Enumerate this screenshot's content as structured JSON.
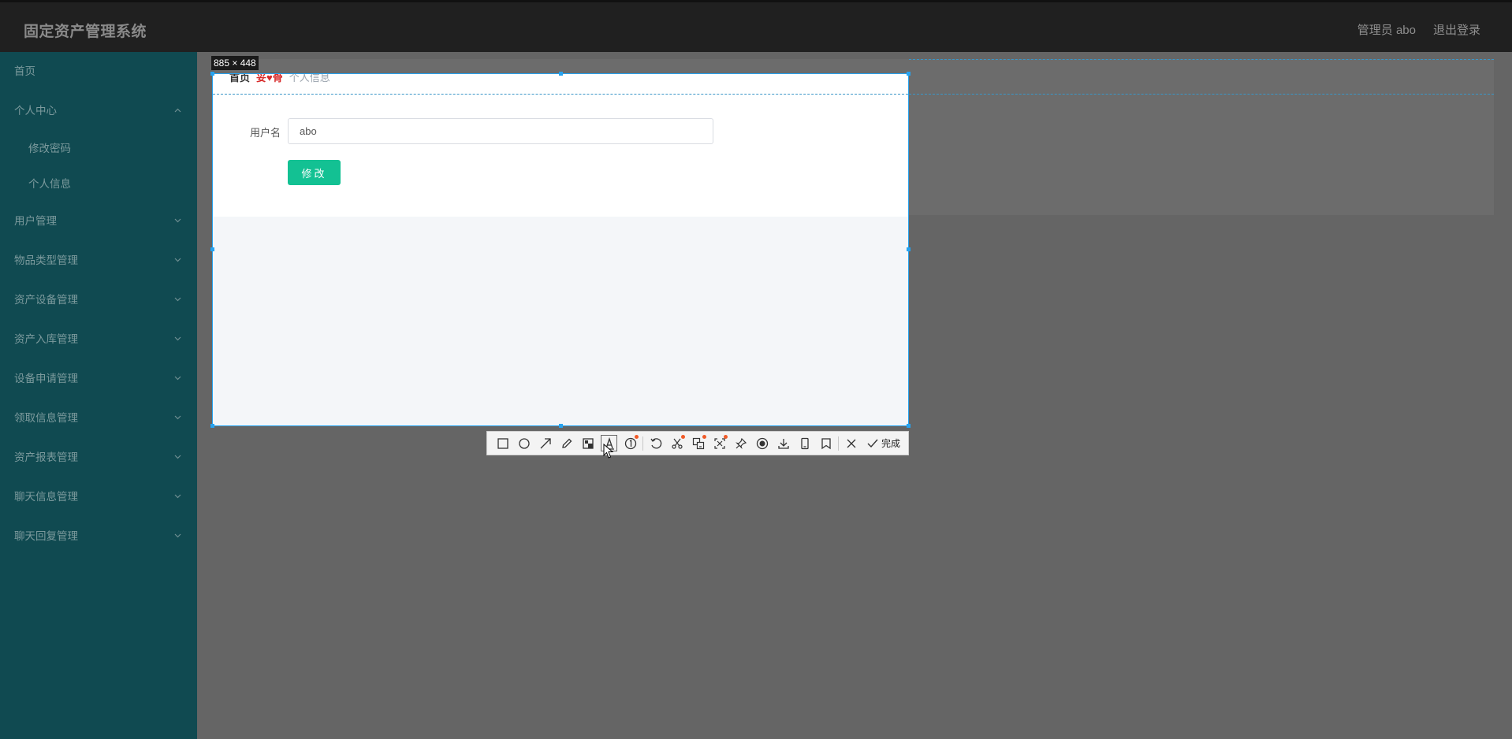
{
  "header": {
    "app_title": "固定资产管理系统",
    "user_label": "管理员 abo",
    "logout_label": "退出登录"
  },
  "sidebar": {
    "items": [
      {
        "label": "首页",
        "name": "sidebar-item-home",
        "type": "top",
        "chevron": "none"
      },
      {
        "label": "个人中心",
        "name": "sidebar-item-personal-center",
        "type": "top",
        "chevron": "up"
      },
      {
        "label": "修改密码",
        "name": "sidebar-item-change-password",
        "type": "sub",
        "chevron": "none"
      },
      {
        "label": "个人信息",
        "name": "sidebar-item-personal-info",
        "type": "sub",
        "chevron": "none"
      },
      {
        "label": "用户管理",
        "name": "sidebar-item-user-management",
        "type": "top",
        "chevron": "down"
      },
      {
        "label": "物品类型管理",
        "name": "sidebar-item-item-type-management",
        "type": "top",
        "chevron": "down"
      },
      {
        "label": "资产设备管理",
        "name": "sidebar-item-asset-equipment-management",
        "type": "top",
        "chevron": "down"
      },
      {
        "label": "资产入库管理",
        "name": "sidebar-item-asset-warehousing-management",
        "type": "top",
        "chevron": "down"
      },
      {
        "label": "设备申请管理",
        "name": "sidebar-item-equipment-application-management",
        "type": "top",
        "chevron": "down"
      },
      {
        "label": "领取信息管理",
        "name": "sidebar-item-collection-info-management",
        "type": "top",
        "chevron": "down"
      },
      {
        "label": "资产报表管理",
        "name": "sidebar-item-asset-report-management",
        "type": "top",
        "chevron": "down"
      },
      {
        "label": "聊天信息管理",
        "name": "sidebar-item-chat-info-management",
        "type": "top",
        "chevron": "down"
      },
      {
        "label": "聊天回复管理",
        "name": "sidebar-item-chat-reply-management",
        "type": "top",
        "chevron": "down"
      }
    ]
  },
  "breadcrumb": {
    "home": "首页",
    "separator": "妥♥骨",
    "current": "个人信息"
  },
  "form": {
    "username_label": "用户名",
    "username_value": "abo",
    "submit_label": "修改"
  },
  "screenshot_tool": {
    "size_label": "885 × 448",
    "accent_color": "#27a3f0",
    "done_label": "完成",
    "tools": [
      {
        "name": "rectangle-icon",
        "badge": false,
        "active": false
      },
      {
        "name": "ellipse-icon",
        "badge": false,
        "active": false
      },
      {
        "name": "arrow-icon",
        "badge": false,
        "active": false
      },
      {
        "name": "pen-icon",
        "badge": false,
        "active": false
      },
      {
        "name": "mosaic-icon",
        "badge": false,
        "active": false
      },
      {
        "name": "text-icon",
        "badge": false,
        "active": true
      },
      {
        "name": "numbered-marker-icon",
        "badge": true,
        "active": false
      },
      {
        "name": "undo-icon",
        "badge": false,
        "active": false
      },
      {
        "name": "scissors-icon",
        "badge": true,
        "active": false
      },
      {
        "name": "translate-icon",
        "badge": true,
        "active": false
      },
      {
        "name": "ocr-scan-icon",
        "badge": true,
        "active": false
      },
      {
        "name": "pin-icon",
        "badge": false,
        "active": false
      },
      {
        "name": "record-icon",
        "badge": false,
        "active": false
      },
      {
        "name": "download-icon",
        "badge": false,
        "active": false
      },
      {
        "name": "mobile-icon",
        "badge": false,
        "active": false
      },
      {
        "name": "bookmark-icon",
        "badge": false,
        "active": false
      },
      {
        "name": "close-icon",
        "badge": false,
        "active": false
      }
    ]
  },
  "colors": {
    "sidebar_bg": "#104a51",
    "header_bg": "#202020",
    "primary_button": "#13c193"
  }
}
